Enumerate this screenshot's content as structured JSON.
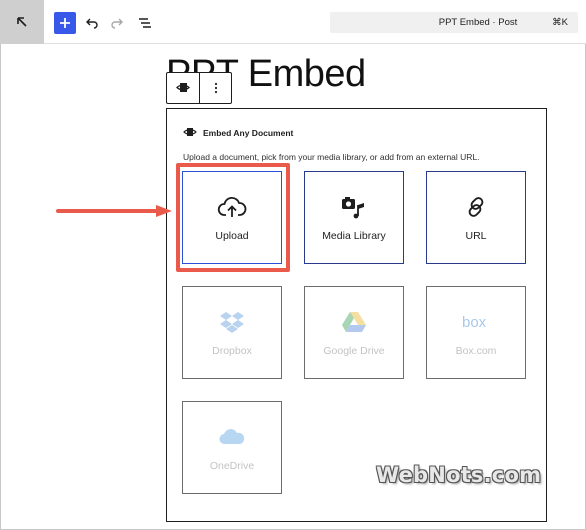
{
  "topbar": {
    "document_title": "PPT Embed · Post",
    "shortcut": "⌘K"
  },
  "post": {
    "title": "PPT Embed"
  },
  "block": {
    "heading": "Embed Any Document",
    "description": "Upload a document, pick from your media library, or add from an external URL.",
    "options": [
      {
        "label": "Upload",
        "icon": "cloud-upload-icon",
        "state": "selected"
      },
      {
        "label": "Media Library",
        "icon": "media-library-icon",
        "state": "enabled"
      },
      {
        "label": "URL",
        "icon": "link-icon",
        "state": "enabled"
      },
      {
        "label": "Dropbox",
        "icon": "dropbox-icon",
        "state": "disabled"
      },
      {
        "label": "Google Drive",
        "icon": "google-drive-icon",
        "state": "disabled"
      },
      {
        "label": "Box.com",
        "icon": "box-icon",
        "state": "disabled"
      },
      {
        "label": "OneDrive",
        "icon": "onedrive-icon",
        "state": "disabled"
      }
    ]
  },
  "annotation": {
    "highlight_color": "#e95a4a",
    "watermark": "WebNots.com"
  },
  "colors": {
    "accent": "#3858e9"
  }
}
